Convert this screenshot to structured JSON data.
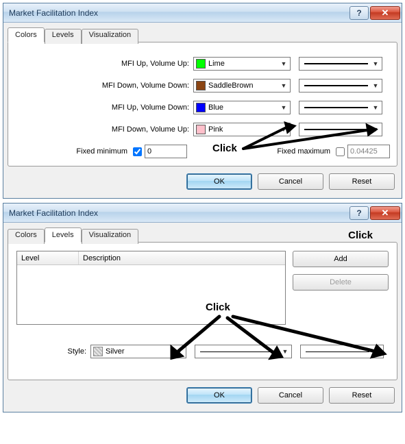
{
  "dialog1": {
    "title": "Market Facilitation Index",
    "tabs": {
      "colors": "Colors",
      "levels": "Levels",
      "viz": "Visualization"
    },
    "rows": [
      {
        "label": "MFI Up, Volume Up:",
        "color_name": "Lime",
        "hex": "#00ff00"
      },
      {
        "label": "MFI Down, Volume Down:",
        "color_name": "SaddleBrown",
        "hex": "#8b4513"
      },
      {
        "label": "MFI Up, Volume Down:",
        "color_name": "Blue",
        "hex": "#0000ff"
      },
      {
        "label": "MFI Down, Volume Up:",
        "color_name": "Pink",
        "hex": "#ffc0cb"
      }
    ],
    "fixed_min": {
      "label": "Fixed minimum",
      "checked": true,
      "value": "0"
    },
    "fixed_max": {
      "label": "Fixed maximum",
      "checked": false,
      "value": "0.04425"
    },
    "buttons": {
      "ok": "OK",
      "cancel": "Cancel",
      "reset": "Reset"
    },
    "annotation": "Click"
  },
  "dialog2": {
    "title": "Market Facilitation Index",
    "tabs": {
      "colors": "Colors",
      "levels": "Levels",
      "viz": "Visualization"
    },
    "columns": {
      "level": "Level",
      "desc": "Description"
    },
    "add": "Add",
    "delete": "Delete",
    "style_label": "Style:",
    "style_value": "Silver",
    "buttons": {
      "ok": "OK",
      "cancel": "Cancel",
      "reset": "Reset"
    },
    "annotation_click": "Click",
    "annotation_click2": "Click"
  }
}
